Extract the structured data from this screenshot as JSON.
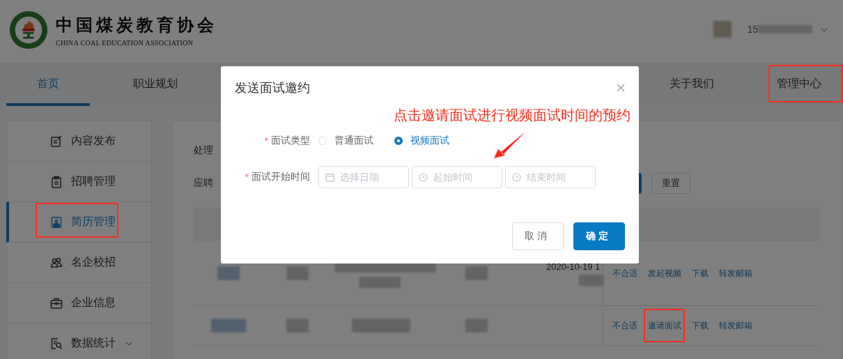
{
  "header": {
    "title": "中国煤炭教育协会",
    "subtitle": "CHINA COAL EDUCATION ASSOCIATION",
    "user_phone": "15"
  },
  "nav_tabs": [
    {
      "label": "首页",
      "selected": true,
      "highlighted": false
    },
    {
      "label": "职业规划",
      "selected": false,
      "highlighted": false
    },
    {
      "label": "关于我们",
      "selected": false,
      "highlighted": false
    },
    {
      "label": "管理中心",
      "selected": false,
      "highlighted": true
    }
  ],
  "sidebar": {
    "items": [
      {
        "label": "内容发布",
        "selected": false,
        "highlighted": false,
        "expandable": false
      },
      {
        "label": "招聘管理",
        "selected": false,
        "highlighted": false,
        "expandable": false
      },
      {
        "label": "简历管理",
        "selected": true,
        "highlighted": true,
        "expandable": false
      },
      {
        "label": "名企校招",
        "selected": false,
        "highlighted": false,
        "expandable": false
      },
      {
        "label": "企业信息",
        "selected": false,
        "highlighted": false,
        "expandable": false
      },
      {
        "label": "数据统计",
        "selected": false,
        "highlighted": false,
        "expandable": true
      }
    ]
  },
  "filters": {
    "labels": [
      "处理",
      "应聘"
    ],
    "reset_button": "重置"
  },
  "table": {
    "rows": [
      {
        "date": "2020-10-19 1",
        "actions": [
          {
            "label": "不合适",
            "highlighted": false
          },
          {
            "label": "发起视频",
            "highlighted": false
          },
          {
            "label": "下载",
            "highlighted": false
          },
          {
            "label": "转发邮箱",
            "highlighted": false
          }
        ]
      },
      {
        "actions": [
          {
            "label": "不合适",
            "highlighted": false
          },
          {
            "label": "邀请面试",
            "highlighted": true
          },
          {
            "label": "下载",
            "highlighted": false
          },
          {
            "label": "转发邮箱",
            "highlighted": false
          }
        ]
      }
    ]
  },
  "dialog": {
    "title": "发送面试邀约",
    "annotation": "点击邀请面试进行视频面试时间的预约",
    "fields": [
      {
        "kind": "radio",
        "label": "面试类型",
        "required_mark": "*",
        "options": [
          {
            "label": "普通面试",
            "selected": false
          },
          {
            "label": "视频面试",
            "selected": true
          }
        ]
      },
      {
        "kind": "pickers",
        "label": "面试开始时间",
        "required_mark": "*",
        "inputs": [
          {
            "placeholder": "选择日期"
          },
          {
            "placeholder": "起始时间"
          },
          {
            "placeholder": "结束时间"
          }
        ]
      }
    ],
    "buttons": [
      {
        "label": "取消",
        "kind": "secondary"
      },
      {
        "label": "确定",
        "kind": "primary"
      }
    ]
  }
}
